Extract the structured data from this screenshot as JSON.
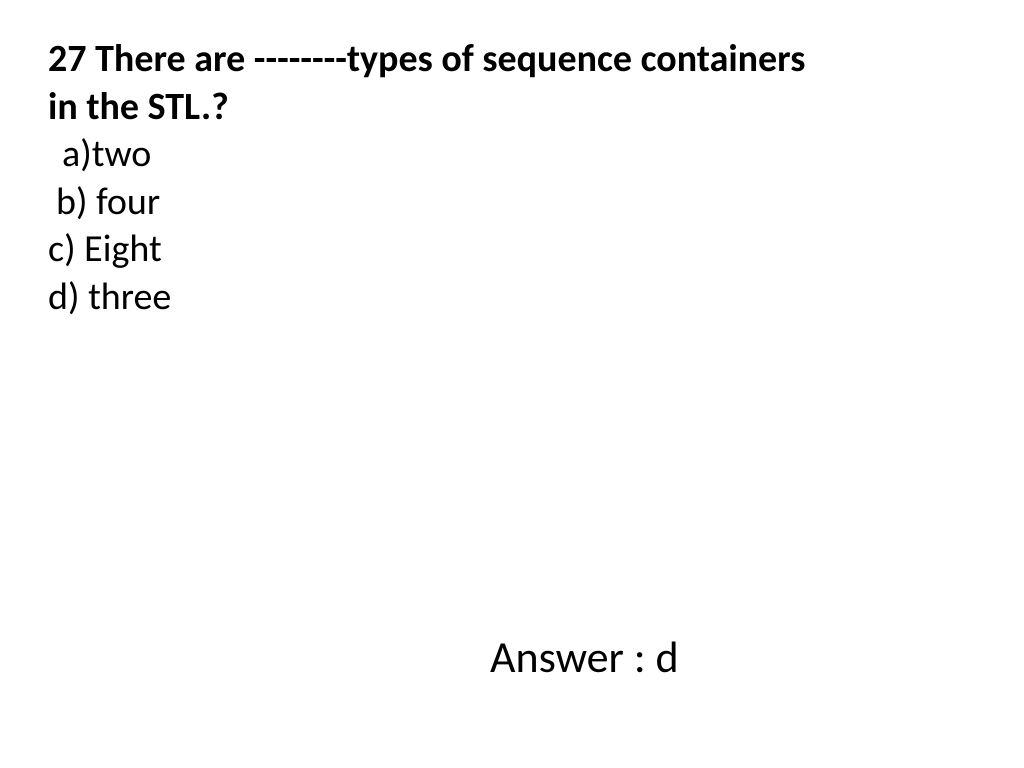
{
  "question": {
    "number": "27",
    "text_line1": "27  There are --------types of sequence containers",
    "text_line2": "in the STL.?",
    "options": {
      "a": "a)two",
      "b": "b) four",
      "c": "c) Eight",
      "d": "d) three"
    }
  },
  "answer": {
    "label": "Answer : d"
  }
}
